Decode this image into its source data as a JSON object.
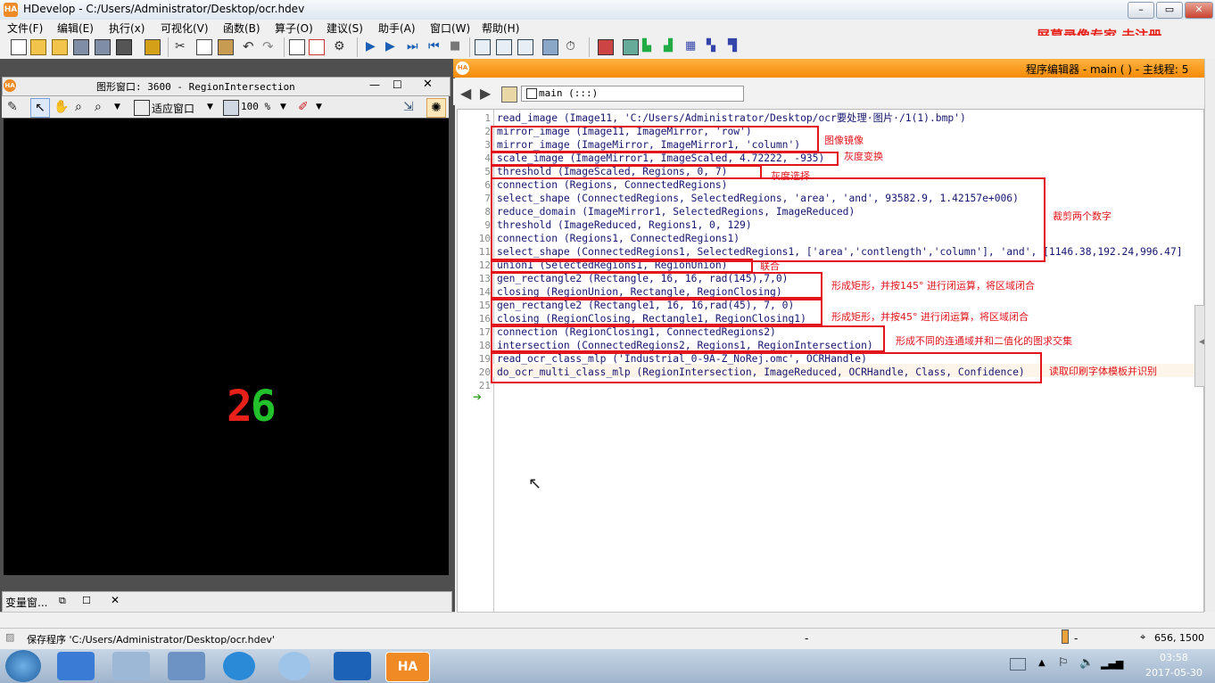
{
  "window": {
    "title": "HDevelop - C:/Users/Administrator/Desktop/ocr.hdev",
    "logo": "HA"
  },
  "menu": [
    "文件(F)",
    "编辑(E)",
    "执行(x)",
    "可视化(V)",
    "函数(B)",
    "算子(O)",
    "建议(S)",
    "助手(A)",
    "窗口(W)",
    "帮助(H)"
  ],
  "watermark": "屏幕录像专家  未注册",
  "graphics_window": {
    "title": "图形窗口: 3600 - RegionIntersection",
    "fit_label": "适应窗口",
    "zoom": "100 %",
    "digit_left": "2",
    "digit_right": "6",
    "digit_left_color": "#e8201a",
    "digit_right_color": "#22c02a"
  },
  "variable_window": {
    "title": "变量窗..."
  },
  "program_editor": {
    "header": "程序编辑器 - main ( ) - 主线程: 5",
    "procedure": "main (:::)"
  },
  "code_lines": [
    "read_image (Image11, 'C:/Users/Administrator/Desktop/ocr要处理·图片·/1(1).bmp')",
    "mirror_image (Image11, ImageMirror, 'row')",
    "mirror_image (ImageMirror, ImageMirror1, 'column')",
    "scale_image (ImageMirror1, ImageScaled, 4.72222, -935)",
    "threshold (ImageScaled, Regions, 0, 7)",
    "connection (Regions, ConnectedRegions)",
    "select_shape (ConnectedRegions, SelectedRegions, 'area', 'and', 93582.9, 1.42157e+006)",
    "reduce_domain (ImageMirror1, SelectedRegions, ImageReduced)",
    "threshold (ImageReduced, Regions1, 0, 129)",
    "connection (Regions1, ConnectedRegions1)",
    "select_shape (ConnectedRegions1, SelectedRegions1, ['area','contlength','column'], 'and', [1146.38,192.24,996.47]",
    "union1 (SelectedRegions1, RegionUnion)",
    "gen_rectangle2 (Rectangle, 16, 16, rad(145),7,0)",
    "closing (RegionUnion, Rectangle, RegionClosing)",
    "gen_rectangle2 (Rectangle1, 16, 16,rad(45), 7, 0)",
    "closing (RegionClosing, Rectangle1, RegionClosing1)",
    "connection (RegionClosing1, ConnectedRegions2)",
    "intersection (ConnectedRegions2, Regions1, RegionIntersection)",
    "read_ocr_class_mlp ('Industrial_0-9A-Z_NoRej.omc', OCRHandle)",
    "do_ocr_multi_class_mlp (RegionIntersection, ImageReduced, OCRHandle, Class, Confidence)",
    ""
  ],
  "annotations": {
    "mirror": "图像镜像",
    "scale": "灰度变换",
    "threshold": "灰度选择",
    "crop": "裁剪两个数字",
    "union": "联合",
    "close145": "形成矩形，并按145° 进行闭运算，将区域闭合",
    "close45": "形成矩形，并按45° 进行闭运算，将区域闭合",
    "intersect": "形成不同的连通域并和二值化的图求交集",
    "ocr": "读取印刷字体模板并识别"
  },
  "status": {
    "message": "保存程序 'C:/Users/Administrator/Desktop/ocr.hdev'",
    "dash1": "-",
    "dash2": "-",
    "coords": "656,  1500"
  },
  "taskbar": {
    "time": "03:58",
    "date": "2017-05-30"
  }
}
